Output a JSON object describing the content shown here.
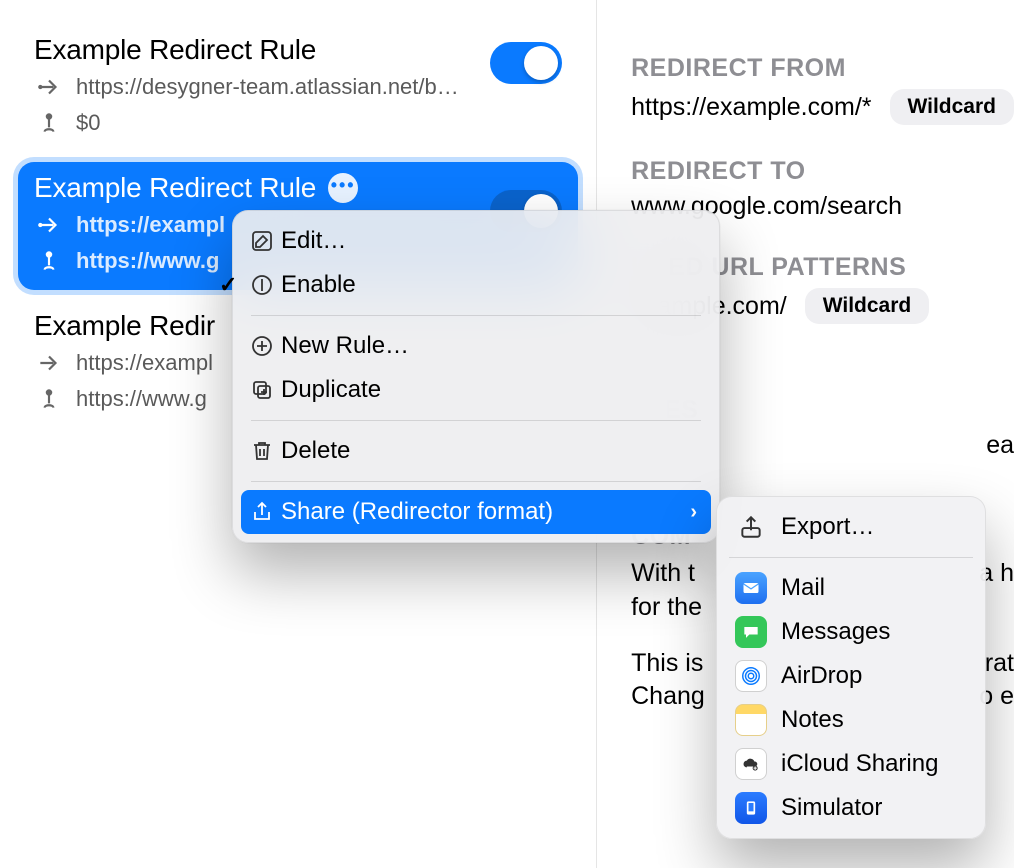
{
  "rules": [
    {
      "title": "Example Redirect Rule",
      "from": "https://desygner-team.atlassian.net/b…",
      "to": "$0",
      "enabled": true,
      "selected": false
    },
    {
      "title": "Example Redirect Rule",
      "from": "https://exampl",
      "to": "https://www.g",
      "enabled": true,
      "selected": true
    },
    {
      "title": "Example Redir",
      "from": "https://exampl",
      "to": "https://www.g",
      "enabled": false,
      "selected": false
    }
  ],
  "context_menu": {
    "edit": "Edit…",
    "enable": "Enable",
    "new_rule": "New Rule…",
    "duplicate": "Duplicate",
    "delete": "Delete",
    "share": "Share (Redirector format)"
  },
  "share_menu": {
    "export": "Export…",
    "mail": "Mail",
    "messages": "Messages",
    "airdrop": "AirDrop",
    "notes": "Notes",
    "icloud": "iCloud Sharing",
    "simulator": "Simulator"
  },
  "detail": {
    "from_label": "REDIRECT FROM",
    "from_value": "https://example.com/*",
    "from_badge": "Wildcard",
    "to_label": "REDIRECT TO",
    "to_value": "www.google.com/search",
    "excluded_label": "UDED URL PATTERNS",
    "excluded_value": "example.com/",
    "excluded_badge": "Wildcard",
    "examples_label": "PLES",
    "examples_line": "ea",
    "comments_label": "COM",
    "comments_1a": "With t",
    "comments_1b": "for the",
    "comments_2a": "This is",
    "comments_2b": "Chang",
    "comments_1a_tail": "a h",
    "comments_2a_tail": "rat",
    "comments_2b_tail": "o e"
  }
}
